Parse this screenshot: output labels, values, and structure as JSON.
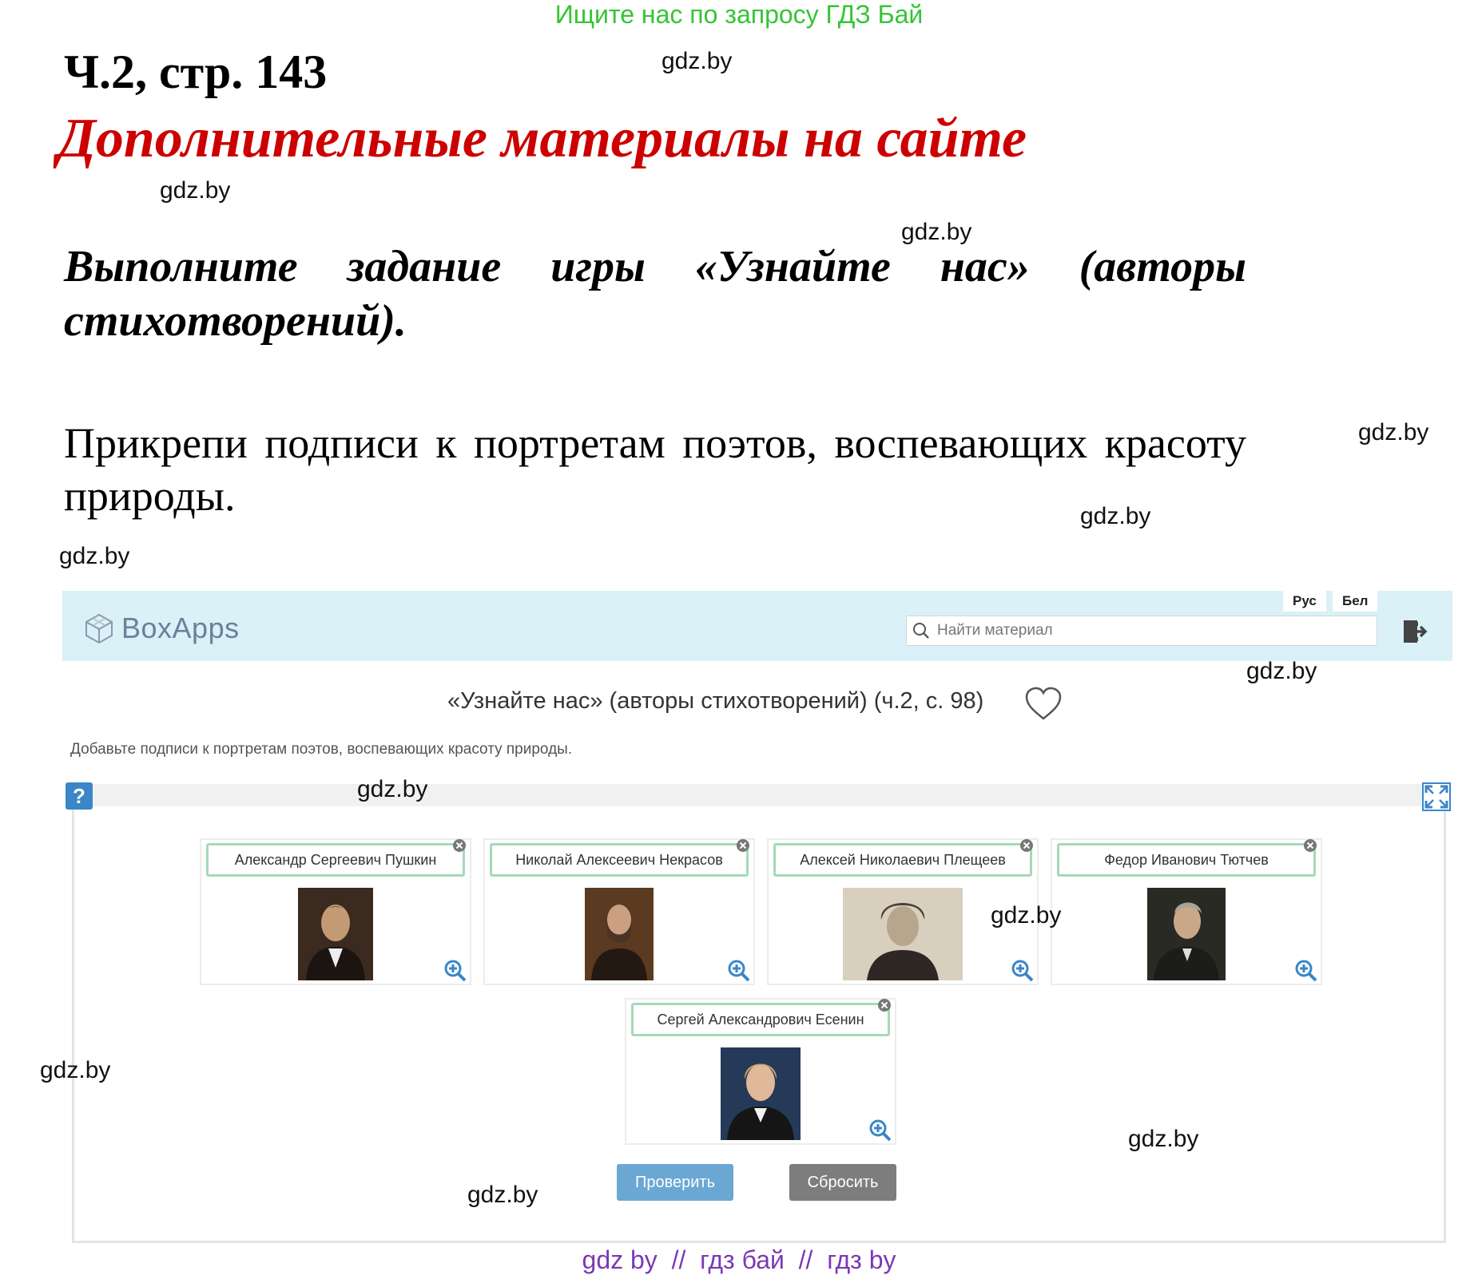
{
  "banner": "Ищите нас по запросу ГДЗ Бай",
  "page_ref": "Ч.2, стр. 143",
  "section_title": "Дополнительные материалы на сайте",
  "task": "Выполните задание игры «Узнайте нас» (авторы стихотворений).",
  "instruction": "Прикрепи подписи к портретам поэтов, воспевающих красоту природы.",
  "watermark": "gdz.by",
  "app": {
    "logo": "BoxApps",
    "lang_ru": "Рус",
    "lang_by": "Бел",
    "search_placeholder": "Найти материал",
    "activity_title": "«Узнайте нас» (авторы стихотворений) (ч.2, с. 98)",
    "description": "Добавьте подписи к портретам поэтов, воспевающих красоту природы.",
    "help": "?",
    "cards": [
      {
        "label": "Александр Сергеевич Пушкин",
        "portrait": "pushkin"
      },
      {
        "label": "Николай Алексеевич Некрасов",
        "portrait": "nekrasov"
      },
      {
        "label": "Алексей Николаевич Плещеев",
        "portrait": "pleshcheev"
      },
      {
        "label": "Федор Иванович Тютчев",
        "portrait": "tyutchev"
      },
      {
        "label": "Сергей Александрович Есенин",
        "portrait": "esenin"
      }
    ],
    "check_button": "Проверить",
    "reset_button": "Сбросить"
  },
  "footer": "gdz by  //  гдз бай  //  гдз by",
  "colors": {
    "banner": "#35c535",
    "title": "#cc0000",
    "header_bg": "#d9f1f7",
    "chip_border": "#a5d9b8",
    "check": "#6ba7d3",
    "reset": "#7d7d7d",
    "footer": "#7b39b5"
  }
}
